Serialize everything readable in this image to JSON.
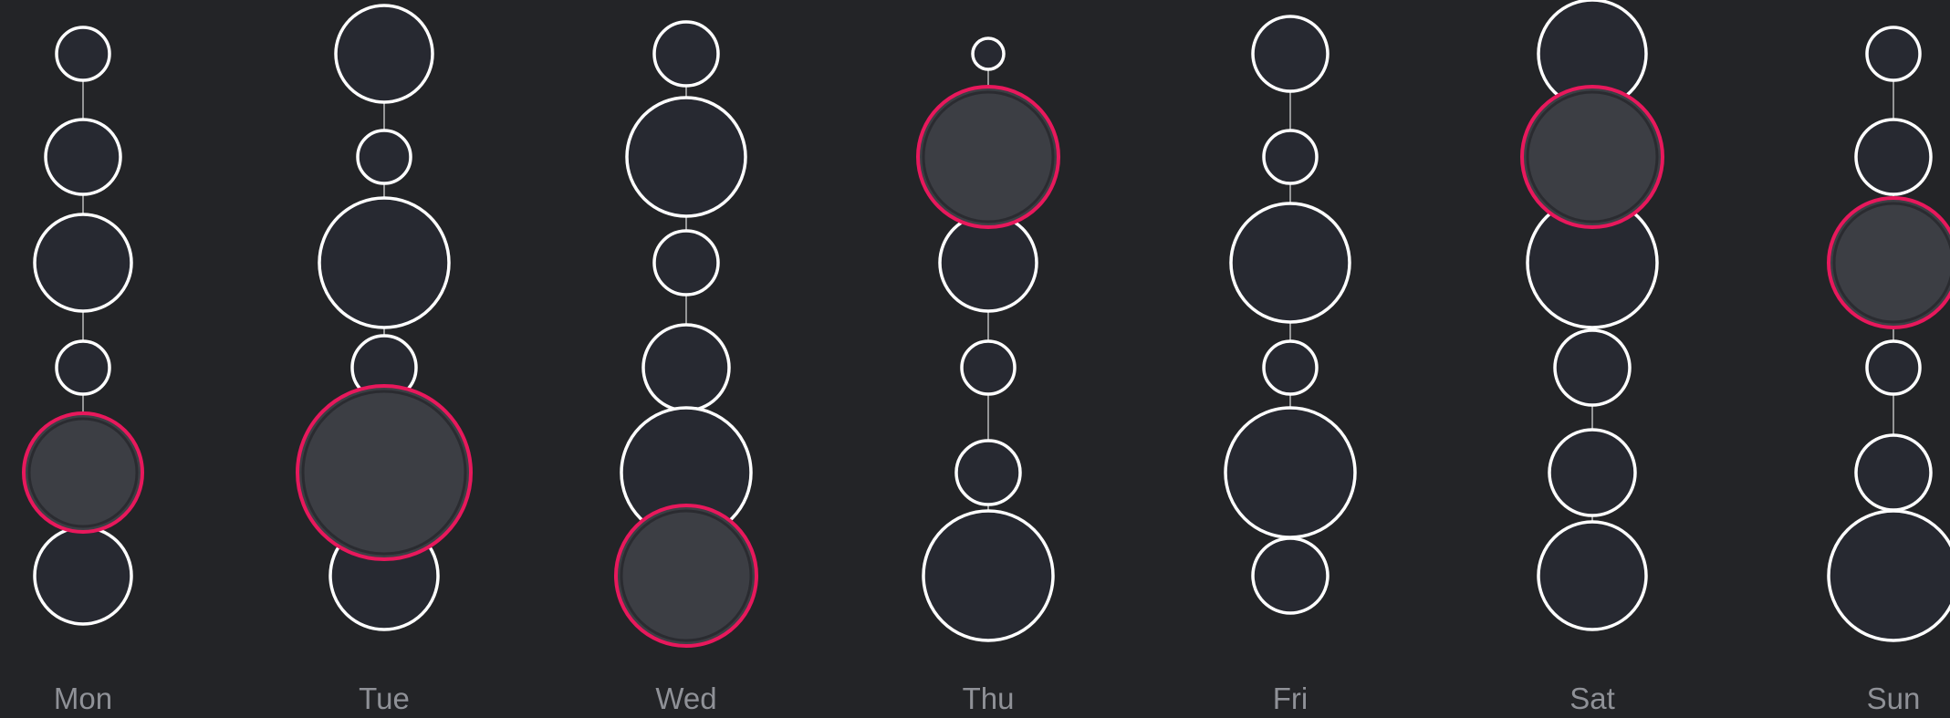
{
  "chart_data": {
    "type": "scatter",
    "title": "",
    "xlabel": "",
    "ylabel": "",
    "categories": [
      "Mon",
      "Tue",
      "Wed",
      "Thu",
      "Fri",
      "Sat",
      "Sun"
    ],
    "rows": 6,
    "series": [
      {
        "category": "Mon",
        "sizes": [
          3,
          5,
          7,
          3,
          9,
          7
        ],
        "highlight_row": 4
      },
      {
        "category": "Tue",
        "sizes": [
          7,
          3,
          10,
          4,
          14,
          8
        ],
        "highlight_row": 4
      },
      {
        "category": "Wed",
        "sizes": [
          4,
          9,
          4,
          6,
          10,
          11
        ],
        "highlight_row": 5
      },
      {
        "category": "Thu",
        "sizes": [
          1,
          11,
          7,
          3,
          4,
          10
        ],
        "highlight_row": 1
      },
      {
        "category": "Fri",
        "sizes": [
          5,
          3,
          9,
          3,
          10,
          5
        ],
        "highlight_row": null
      },
      {
        "category": "Sat",
        "sizes": [
          8,
          11,
          10,
          5,
          6,
          8
        ],
        "highlight_row": 1
      },
      {
        "category": "Sun",
        "sizes": [
          3,
          5,
          10,
          3,
          5,
          10
        ],
        "highlight_row": 2
      }
    ],
    "colors": {
      "background": "#232427",
      "bubble_fill": "#272931",
      "bubble_stroke": "#ffffff",
      "highlight_fill": "#3c3e44",
      "highlight_stroke": "#e8185c",
      "connector": "#bbbbbb",
      "label": "#8f9197"
    }
  }
}
